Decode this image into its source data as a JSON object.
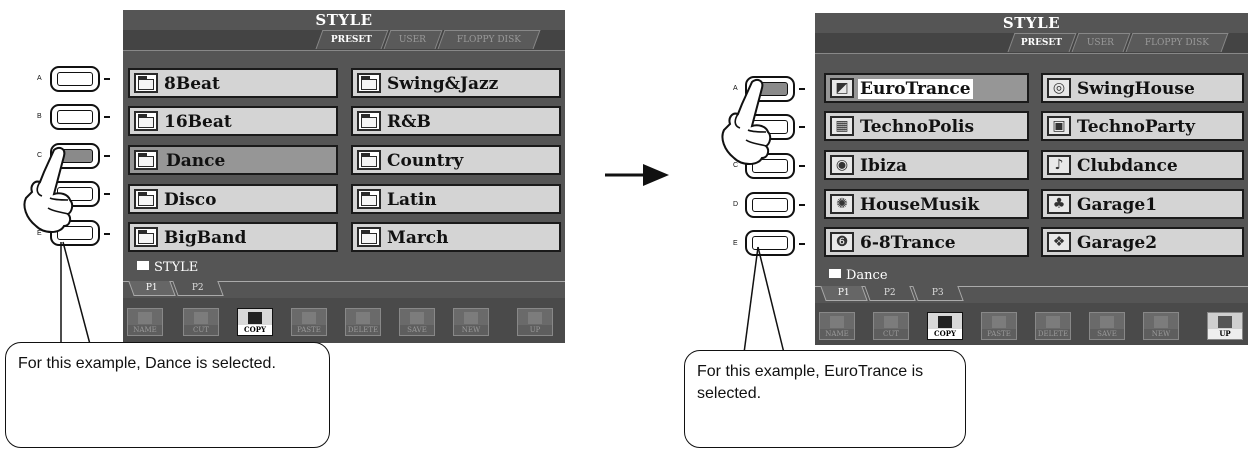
{
  "left_screen": {
    "title": "STYLE",
    "tabs": [
      "PRESET",
      "USER",
      "FLOPPY DISK"
    ],
    "items_left": [
      "8Beat",
      "16Beat",
      "Dance",
      "Disco",
      "BigBand"
    ],
    "items_right": [
      "Swing&Jazz",
      "R&B",
      "Country",
      "Latin",
      "March"
    ],
    "selected": "Dance",
    "current_path": "STYLE",
    "pages": [
      "P1",
      "P2"
    ],
    "functions": [
      "NAME",
      "CUT",
      "COPY",
      "PASTE",
      "DELETE",
      "SAVE",
      "NEW",
      "UP"
    ],
    "active_function": "COPY"
  },
  "right_screen": {
    "title": "STYLE",
    "tabs": [
      "PRESET",
      "USER",
      "FLOPPY DISK"
    ],
    "items_left": [
      "EuroTrance",
      "TechnoPolis",
      "Ibiza",
      "HouseMusik",
      "6-8Trance"
    ],
    "items_right": [
      "SwingHouse",
      "TechnoParty",
      "Clubdance",
      "Garage1",
      "Garage2"
    ],
    "selected": "EuroTrance",
    "current_path": "Dance",
    "pages": [
      "P1",
      "P2",
      "P3"
    ],
    "functions": [
      "NAME",
      "CUT",
      "COPY",
      "PASTE",
      "DELETE",
      "SAVE",
      "NEW",
      "UP"
    ],
    "active_function": "COPY"
  },
  "button_letters": [
    "A",
    "B",
    "C",
    "D",
    "E"
  ],
  "callouts": {
    "left": "For this example, Dance is selected.",
    "right": "For this example, EuroTrance is selected."
  },
  "icons": {
    "folder": "folder-icon",
    "hand": "pointing-hand-icon",
    "arrow": "right-arrow-icon"
  },
  "colors": {
    "screen_bg": "#555555",
    "item_bg": "#d4d4d4",
    "selected_bg": "#969696"
  }
}
